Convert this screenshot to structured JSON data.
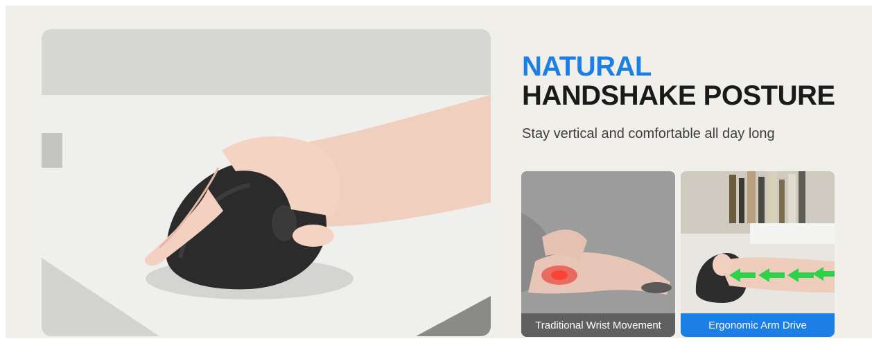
{
  "banner": {
    "headline_line1": "NATURAL",
    "headline_line2": "HANDSHAKE POSTURE",
    "subline": "Stay vertical and comfortable all day long"
  },
  "cards": [
    {
      "label": "Traditional Wrist Movement",
      "label_color": "#505050"
    },
    {
      "label": "Ergonomic Arm Drive",
      "label_color": "#1b7fe6"
    }
  ],
  "colors": {
    "accent": "#1b7fe6",
    "headline": "#1a1a1a",
    "background": "#f1efea",
    "arrows": "#2ed14a",
    "pain_glow": "#e6201a"
  },
  "icons": {
    "hero": "hand-on-vertical-mouse-photo",
    "left_card": "wrist-pain-photo",
    "right_card": "arm-drive-photo-with-arrows"
  }
}
